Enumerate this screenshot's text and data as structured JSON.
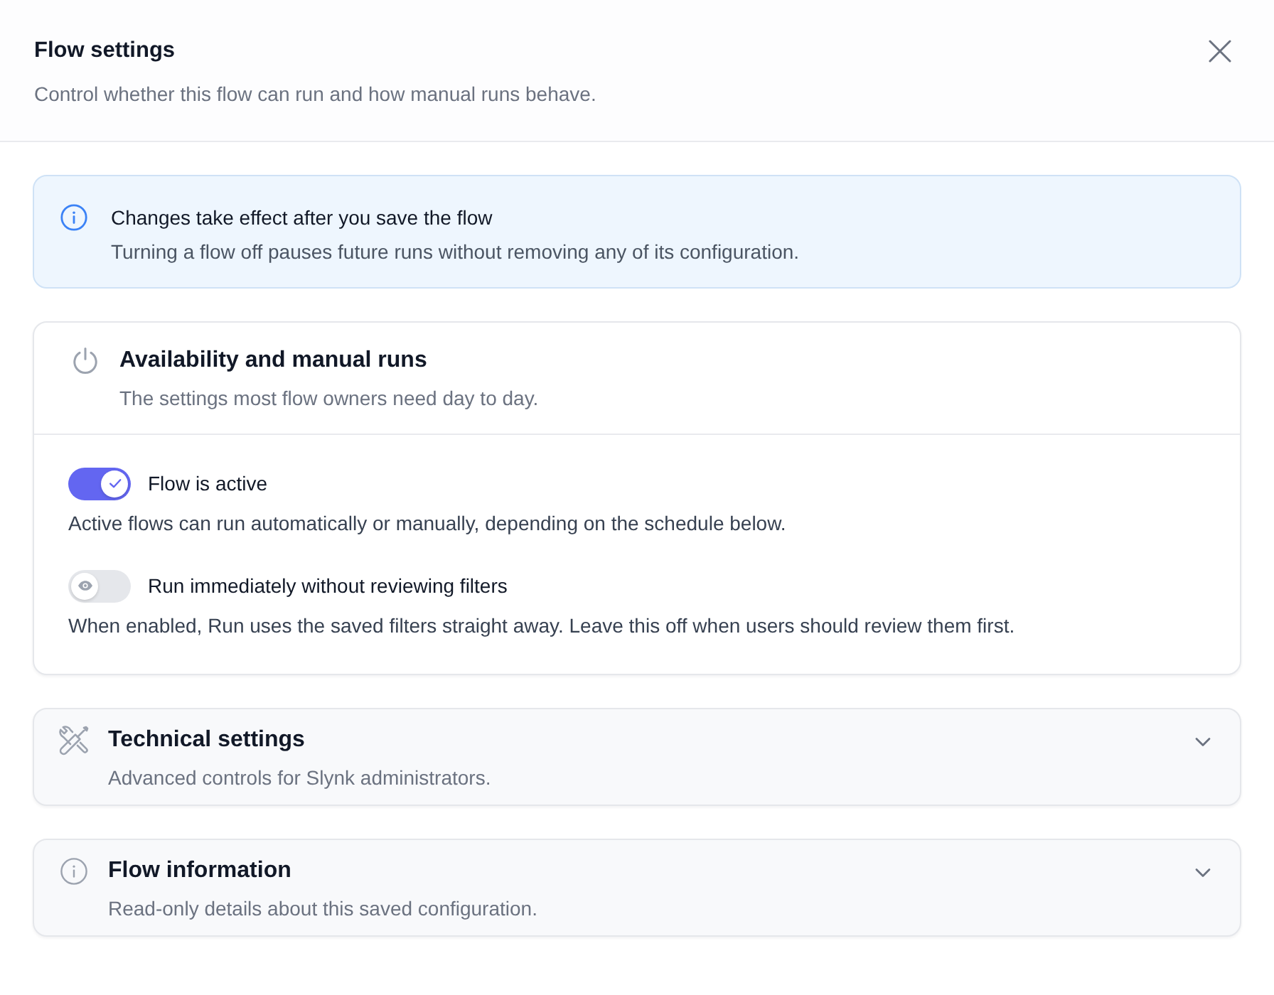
{
  "dialog": {
    "title": "Flow settings",
    "subtitle": "Control whether this flow can run and how manual runs behave."
  },
  "notice": {
    "title": "Changes take effect after you save the flow",
    "text": "Turning a flow off pauses future runs without removing any of its configuration."
  },
  "sections": [
    {
      "kind": "panel",
      "title": "Availability and manual runs",
      "subtitle": "The settings most flow owners need day to day.",
      "settings": [
        {
          "label": "Flow is active",
          "on": true,
          "description": "Active flows can run automatically or manually, depending on the schedule below."
        },
        {
          "label": "Run immediately without reviewing filters",
          "on": false,
          "description": "When enabled, Run uses the saved filters straight away. Leave this off when users should review them first."
        }
      ]
    },
    {
      "kind": "collapsible",
      "title": "Technical settings",
      "subtitle": "Advanced controls for Slynk administrators.",
      "expanded": false
    },
    {
      "kind": "collapsible",
      "title": "Flow information",
      "subtitle": "Read-only details about this saved configuration.",
      "expanded": false
    }
  ]
}
